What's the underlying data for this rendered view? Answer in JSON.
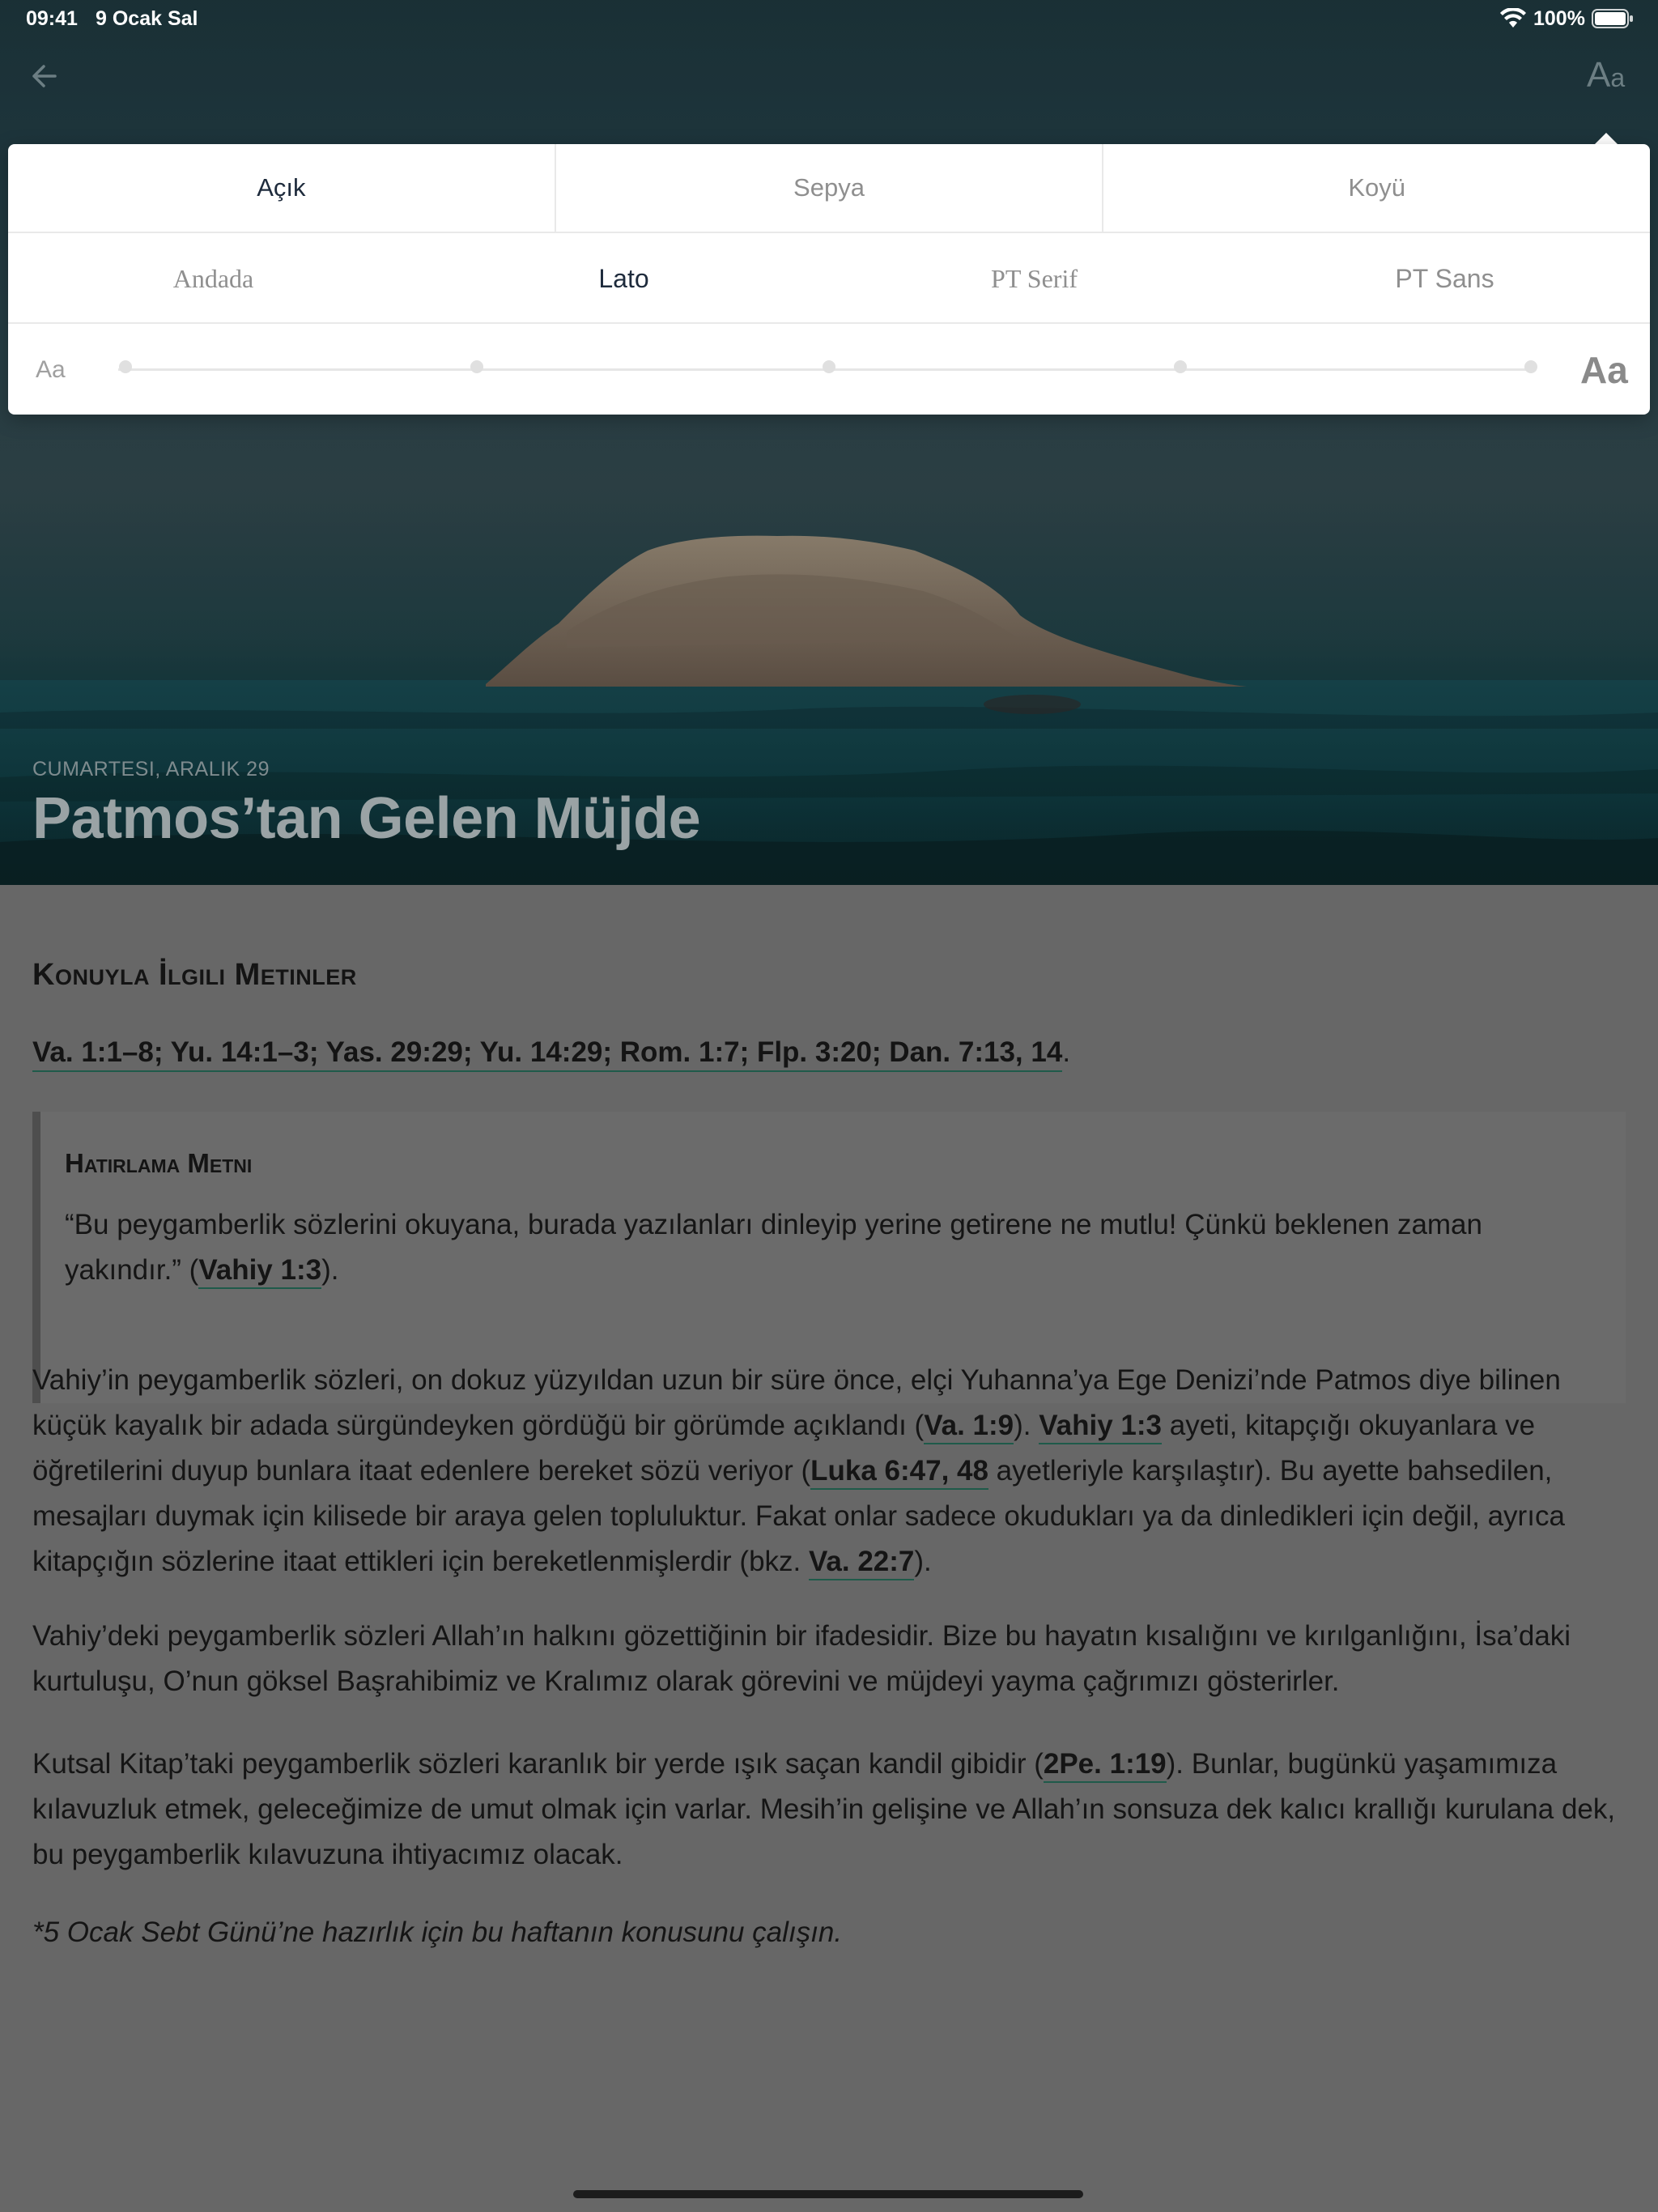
{
  "status_bar": {
    "time": "09:41",
    "date": "9 Ocak Sal",
    "battery": "100%"
  },
  "nav": {
    "back_icon": "arrow-left-icon",
    "text_settings_big": "A",
    "text_settings_small": "a"
  },
  "settings": {
    "themes": [
      "Açık",
      "Sepya",
      "Koyü"
    ],
    "active_theme": "Açık",
    "fonts": [
      "Andada",
      "Lato",
      "PT Serif",
      "PT Sans"
    ],
    "active_font": "Lato",
    "size_small_label": "Aa",
    "size_large_label": "Aa",
    "size_levels": 5,
    "selected_size_level": 1
  },
  "hero": {
    "date": "CUMARTESI, ARALIK 29",
    "title": "Patmos’tan Gelen Müjde"
  },
  "lesson": {
    "related_heading": "Konuyla İlgili Metinler",
    "references": "Va. 1:1–8; Yu. 14:1–3; Yas. 29:29; Yu. 14:29; Rom. 1:7; Flp. 3:20; Dan. 7:13, 14",
    "references_end": ".",
    "memory_heading": "Hatırlama Metni",
    "memory_text_a": "“Bu peygamberlik sözlerini okuyana, burada yazılanları dinleyip yerine getirene ne mutlu! Çünkü beklenen zaman yakındır.” (",
    "memory_link": "Vahiy 1:3",
    "memory_text_b": ").",
    "p1_a": "Vahiy’in peygamberlik sözleri, on dokuz yüzyıldan uzun bir süre önce, elçi Yuhanna’ya Ege Denizi’nde Patmos diye bilinen küçük kayalık bir adada sürgündeyken gördüğü bir görümde açıklandı (",
    "p1_link1": "Va. 1:9",
    "p1_b": "). ",
    "p1_link2": "Vahiy 1:3",
    "p1_c": " ayeti, kitapçığı okuyanlara ve öğretilerini duyup bunlara itaat edenlere bereket sözü veriyor (",
    "p1_link3": "Luka 6:47, 48",
    "p1_d": " ayetleriyle karşılaştır). Bu ayette bahsedilen, mesajları duymak için kilisede bir araya gelen topluluktur. Fakat onlar sadece okudukları ya da dinledikleri için değil, ayrıca kitapçığın sözlerine itaat ettikleri için bereketlenmişlerdir (bkz. ",
    "p1_link4": "Va. 22:7",
    "p1_e": ").",
    "p2": "Vahiy’deki peygamberlik sözleri Allah’ın halkını gözettiğinin bir ifadesidir. Bize bu hayatın kısalığını ve kırılganlığını, İsa’daki kurtuluşu, O’nun göksel Başrahibimiz ve Kralımız olarak görevini ve müjdeyi yayma çağrımızı gösterirler.",
    "p3_a": "Kutsal Kitap’taki peygamberlik sözleri karanlık bir yerde ışık saçan kandil gibidir (",
    "p3_link": "2Pe. 1:19",
    "p3_b": "). Bunlar, bugünkü yaşamımıza kılavuzluk etmek, geleceğimize de umut olmak için varlar. Mesih’in gelişine ve Allah’ın sonsuza dek kalıcı krallığı kurulana dek, bu peygamberlik kılavuzuna ihtiyacımız olacak.",
    "p4": "*5 Ocak Sebt Günü’ne hazırlık için bu haftanın konusunu çalışın."
  },
  "colors": {
    "overlay": "#676767",
    "link_underline": "#1f5a4a",
    "active_text": "#1e2b3c"
  }
}
